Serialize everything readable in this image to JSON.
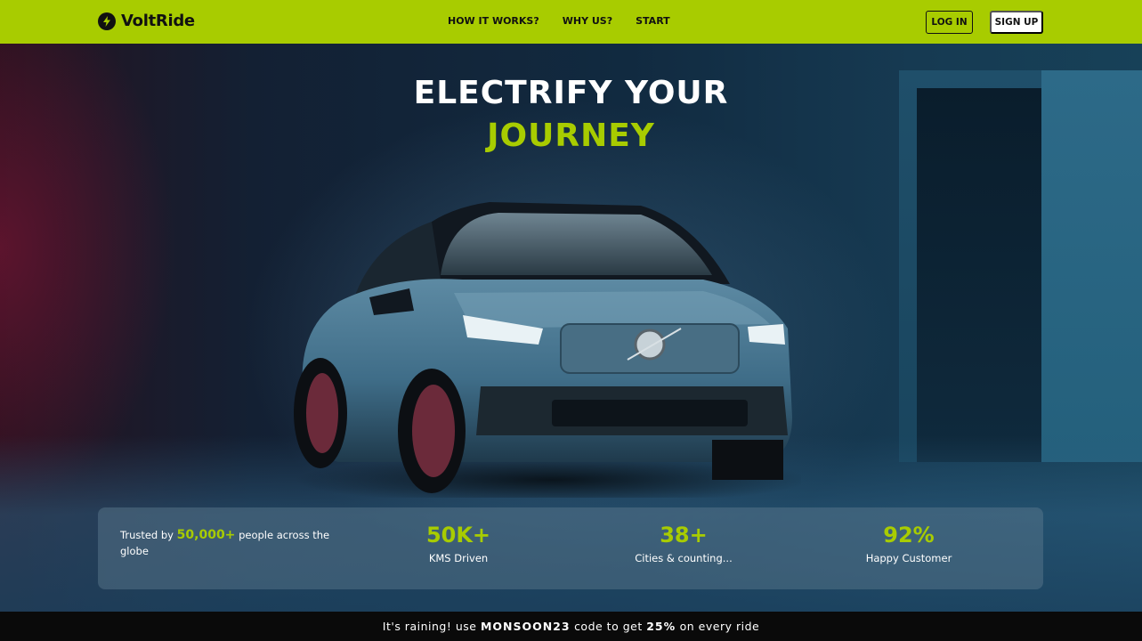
{
  "brand": {
    "name": "VoltRide",
    "icon": "bolt-icon",
    "accent": "#a8cc00"
  },
  "nav": {
    "links": [
      "HOW IT WORKS?",
      "WHY US?",
      "START"
    ],
    "login_label": "LOG IN",
    "signup_label": "SIGN UP"
  },
  "hero": {
    "title_line1": "ELECTRIFY YOUR",
    "title_line2": "JOURNEY"
  },
  "stats": {
    "trusted_prefix": "Trusted by",
    "trusted_count": "50,000+",
    "trusted_suffix": "people across the globe",
    "items": [
      {
        "value": "50K+",
        "label": "KMS Driven"
      },
      {
        "value": "38+",
        "label": "Cities & counting..."
      },
      {
        "value": "92%",
        "label": "Happy Customer"
      }
    ]
  },
  "promo": {
    "prefix": "It's raining! use",
    "code": "MONSOON23",
    "middle": "code to get",
    "discount": "25%",
    "suffix": "on every ride"
  }
}
